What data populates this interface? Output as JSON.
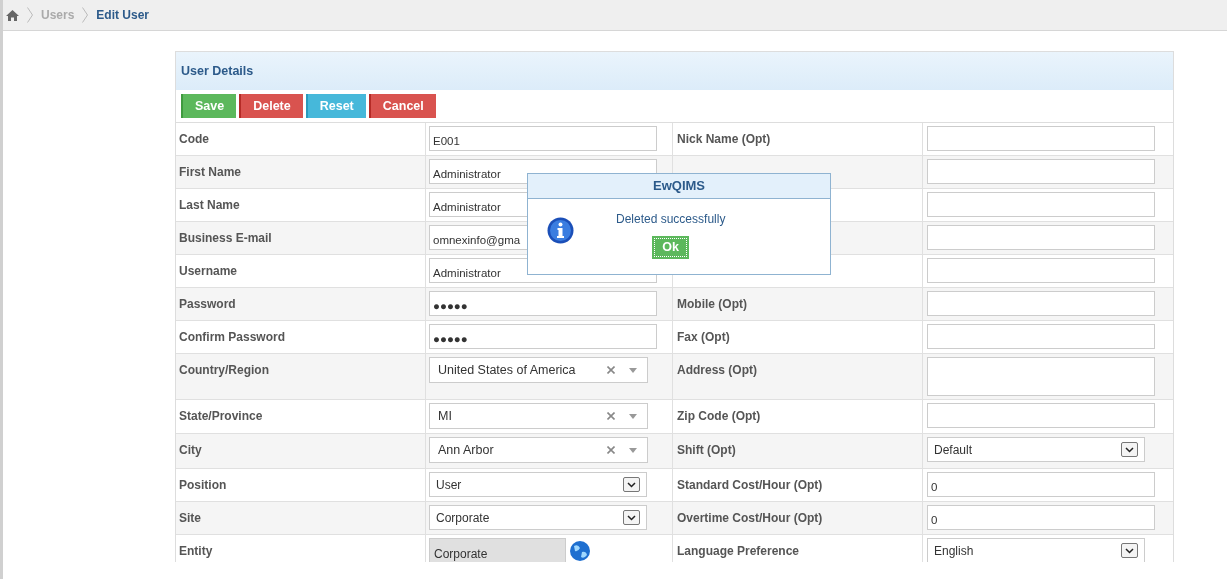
{
  "breadcrumb": [
    {
      "label": "Users",
      "selected": false
    },
    {
      "label": "Edit User",
      "selected": true
    }
  ],
  "panel": {
    "title": "User Details"
  },
  "buttons": [
    {
      "label": "Save",
      "kind": "save"
    },
    {
      "label": "Delete",
      "kind": "delete"
    },
    {
      "label": "Reset",
      "kind": "reset"
    },
    {
      "label": "Cancel",
      "kind": "cancel"
    }
  ],
  "rows": [
    {
      "left": {
        "label": "Code",
        "field": {
          "kind": "text",
          "value": "E001"
        }
      },
      "right": {
        "label": "Nick Name (Opt)",
        "field": {
          "kind": "text"
        }
      }
    },
    {
      "left": {
        "label": "First Name",
        "field": {
          "kind": "text",
          "value": "Administrator"
        }
      },
      "right": {
        "field": {
          "kind": "text"
        }
      }
    },
    {
      "left": {
        "label": "Last Name",
        "field": {
          "kind": "text",
          "value": "Administrator"
        }
      },
      "right": {
        "field": {
          "kind": "text"
        }
      }
    },
    {
      "left": {
        "label": "Business E-mail",
        "field": {
          "kind": "text",
          "value": "omnexinfo@gma"
        }
      },
      "right": {
        "field": {
          "kind": "text"
        }
      }
    },
    {
      "left": {
        "label": "Username",
        "field": {
          "kind": "text",
          "value": "Administrator"
        }
      },
      "right": {
        "field": {
          "kind": "text"
        }
      }
    },
    {
      "left": {
        "label": "Password",
        "field": {
          "kind": "password",
          "value": "●●●●●"
        }
      },
      "right": {
        "label": "Mobile (Opt)",
        "field": {
          "kind": "text"
        }
      }
    },
    {
      "left": {
        "label": "Confirm Password",
        "field": {
          "kind": "password",
          "value": "●●●●●"
        }
      },
      "right": {
        "label": "Fax (Opt)",
        "field": {
          "kind": "text"
        }
      }
    },
    {
      "left": {
        "label": "Country/Region",
        "field": {
          "kind": "combo",
          "value": "United States of America"
        }
      },
      "right": {
        "label": "Address (Opt)",
        "field": {
          "kind": "textarea"
        }
      }
    },
    {
      "left": {
        "label": "State/Province",
        "field": {
          "kind": "combo",
          "value": "MI"
        }
      },
      "right": {
        "label": "Zip Code (Opt)",
        "field": {
          "kind": "text"
        }
      }
    },
    {
      "left": {
        "label": "City",
        "field": {
          "kind": "combo",
          "value": "Ann Arbor"
        }
      },
      "right": {
        "label": "Shift (Opt)",
        "field": {
          "kind": "select",
          "value": "Default"
        }
      }
    },
    {
      "left": {
        "label": "Position",
        "field": {
          "kind": "select",
          "value": "User"
        }
      },
      "right": {
        "label": "Standard Cost/Hour (Opt)",
        "field": {
          "kind": "text",
          "value": "0"
        }
      }
    },
    {
      "left": {
        "label": "Site",
        "field": {
          "kind": "select",
          "value": "Corporate"
        }
      },
      "right": {
        "label": "Overtime Cost/Hour (Opt)",
        "field": {
          "kind": "text",
          "value": "0"
        }
      }
    },
    {
      "left": {
        "label": "Entity",
        "field": {
          "kind": "readonly",
          "value": "Corporate"
        }
      },
      "right": {
        "label": "Language Preference",
        "field": {
          "kind": "select",
          "value": "English"
        }
      }
    }
  ],
  "dialog": {
    "title": "EwQIMS",
    "message": "Deleted successfully",
    "button": "Ok"
  }
}
